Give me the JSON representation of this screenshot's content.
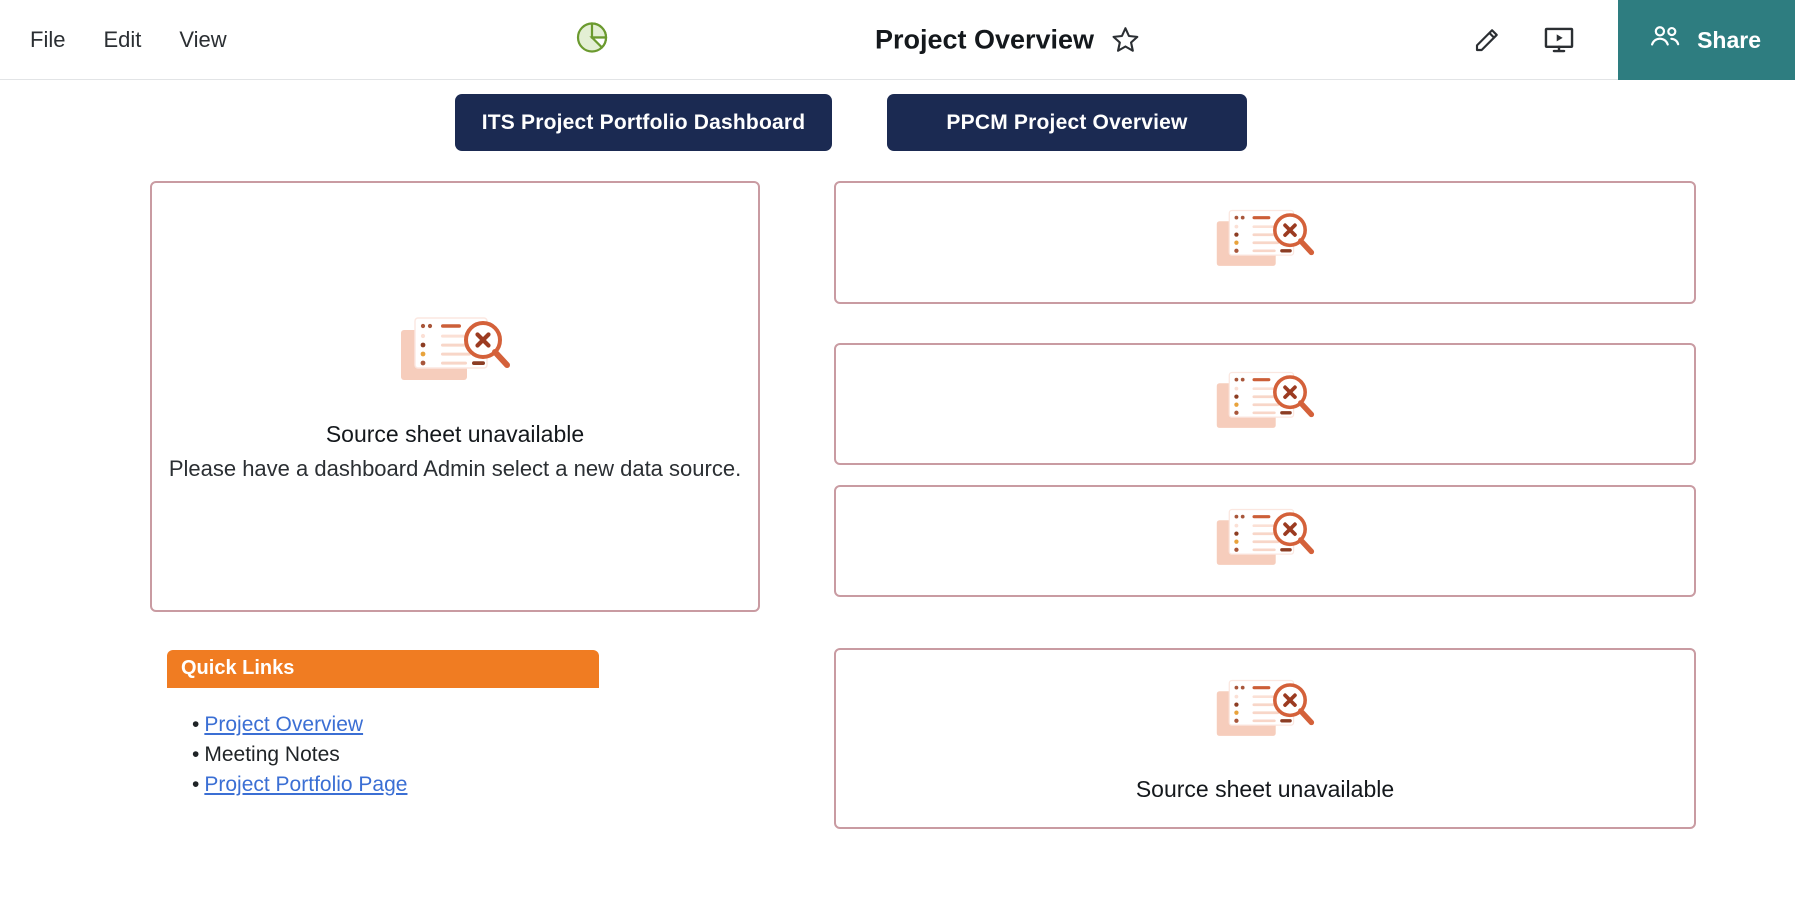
{
  "topbar": {
    "menu": [
      {
        "label": "File"
      },
      {
        "label": "Edit"
      },
      {
        "label": "View"
      }
    ],
    "brand": {
      "icon": "pie-chart-icon",
      "name": ""
    },
    "document_title": "Project Overview",
    "star_icon": "star-outline-icon",
    "tools": [
      {
        "icon": "pencil-edit-icon",
        "name": "edit"
      },
      {
        "icon": "presentation-play-icon",
        "name": "present"
      }
    ],
    "share": {
      "label": "Share",
      "icon": "people-icon",
      "color": "#2e7d80"
    }
  },
  "nav_buttons": [
    {
      "label": "ITS Project Portfolio Dashboard",
      "color": "#1b2a52"
    },
    {
      "label": "PPCM Project Overview",
      "color": "#1b2a52"
    }
  ],
  "cards": [
    {
      "id": "card-main",
      "icon": "source-unavailable-icon",
      "title": "Source sheet unavailable",
      "subtitle": "Please have a dashboard Admin select a new data source.",
      "border_color": "#c99ba2"
    },
    {
      "id": "card-r0",
      "icon": "source-unavailable-icon",
      "title": "",
      "subtitle": "",
      "border_color": "#c99ba2"
    },
    {
      "id": "card-r1",
      "icon": "source-unavailable-icon",
      "title": "",
      "subtitle": "",
      "border_color": "#c99ba2"
    },
    {
      "id": "card-r2",
      "icon": "source-unavailable-icon",
      "title": "",
      "subtitle": "",
      "border_color": "#c99ba2"
    },
    {
      "id": "card-r3",
      "icon": "source-unavailable-icon",
      "title": "Source sheet unavailable",
      "subtitle": "",
      "border_color": "#c99ba2"
    }
  ],
  "quick_links": {
    "header": "Quick Links",
    "header_color": "#f07c22",
    "bullet": "•",
    "items": [
      {
        "label": "Project Overview",
        "is_link": true
      },
      {
        "label": "Meeting Notes",
        "is_link": false
      },
      {
        "label": "Project Portfolio Page",
        "is_link": true
      }
    ]
  }
}
